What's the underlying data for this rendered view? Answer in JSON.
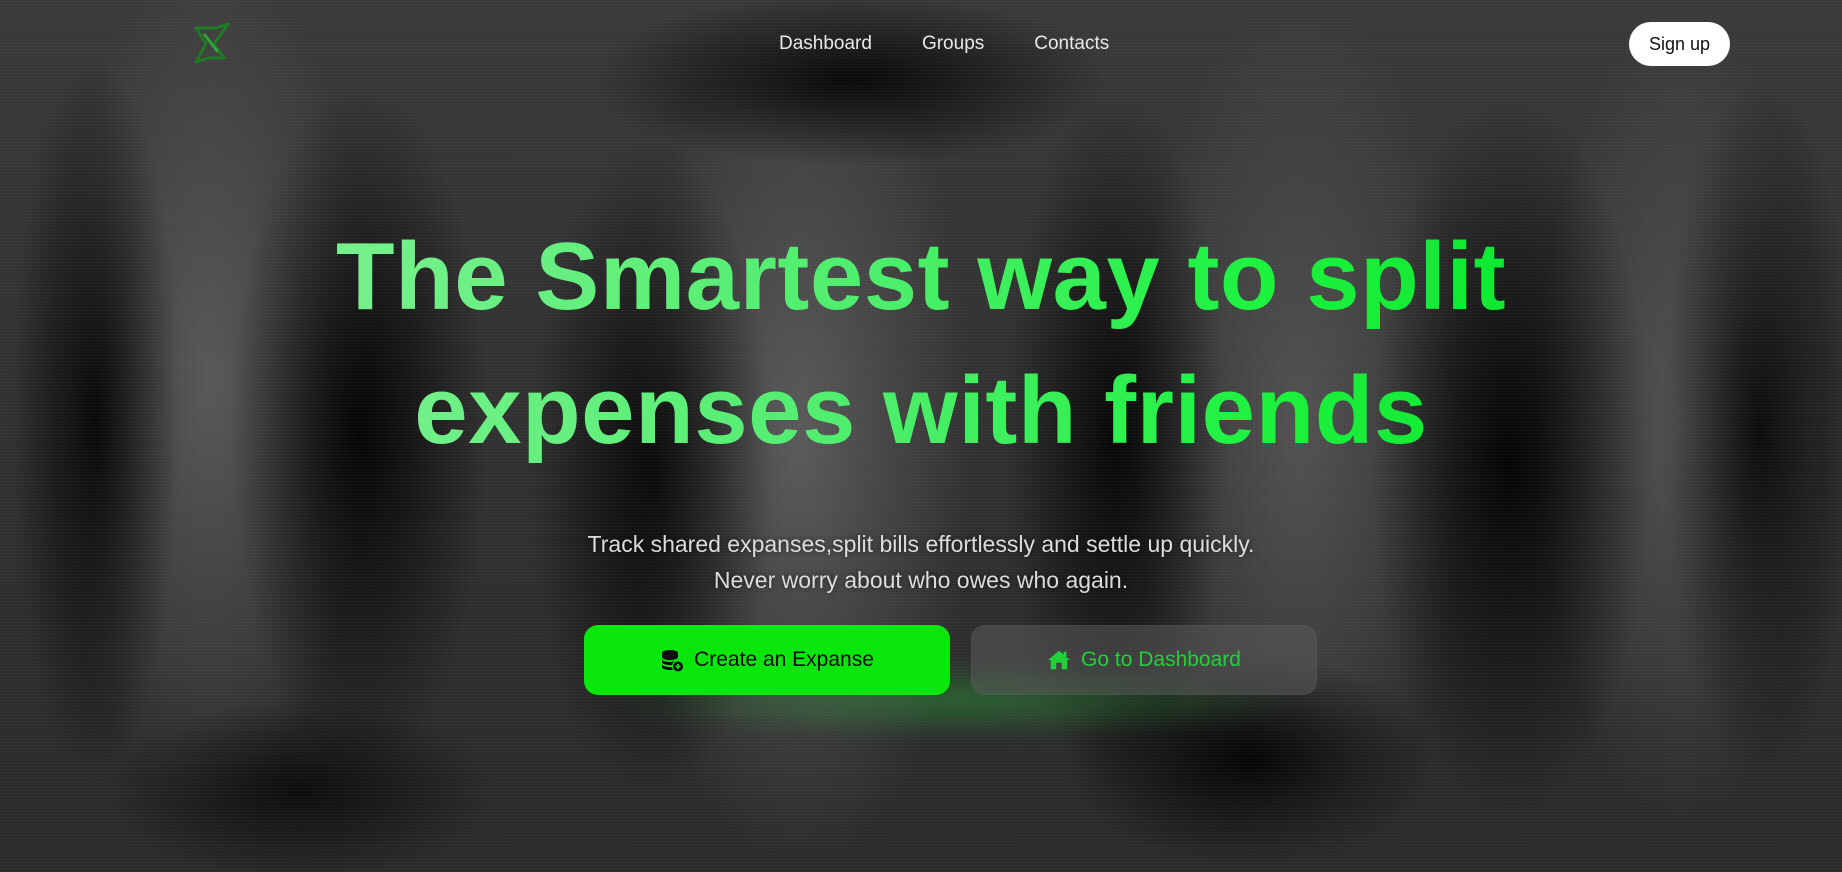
{
  "nav": {
    "logo_icon": "x-chevron-logo-icon",
    "links": [
      "Dashboard",
      "Groups",
      "Contacts"
    ],
    "signup_label": "Sign up"
  },
  "hero": {
    "headline_line1": "The Smartest way to split",
    "headline_line2": "expenses with friends",
    "subtitle_line1": "Track shared expanses,split bills effortlessly and settle up quickly.",
    "subtitle_line2": "Never worry about who owes who again."
  },
  "cta": {
    "primary_label": "Create an Expanse",
    "primary_icon": "coins-plus-icon",
    "secondary_label": "Go to Dashboard",
    "secondary_icon": "home-icon"
  },
  "colors": {
    "accent_green": "#09e60a",
    "headline_green": "#4fee6d",
    "secondary_text_green": "#22d03a"
  }
}
